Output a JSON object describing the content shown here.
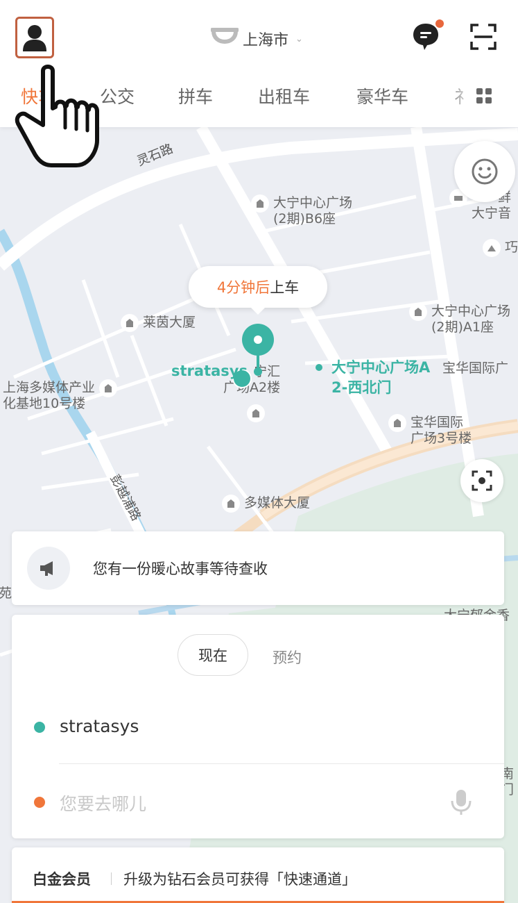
{
  "header": {
    "city": "上海市",
    "tabs": [
      {
        "label": "快车"
      },
      {
        "label": "公交"
      },
      {
        "label": "拼车"
      },
      {
        "label": "出租车"
      },
      {
        "label": "豪华车"
      },
      {
        "label": "礻"
      }
    ],
    "active_tab": "快车",
    "accent_color": "#f0763a",
    "icons": [
      "profile-icon",
      "didi-logo-icon",
      "chevron-down-icon",
      "message-icon",
      "scan-icon",
      "grid-icon"
    ]
  },
  "map": {
    "roads": [
      "灵石路",
      "彭越浦路"
    ],
    "pois": [
      {
        "name": "大宁中心广场\n(2期)B6座"
      },
      {
        "name": "莱茵大厦"
      },
      {
        "name": "大宁中心广场\n(2期)A1座"
      },
      {
        "name": "宝华国际广"
      },
      {
        "name": "上海多媒体产业\n化基地10号楼"
      },
      {
        "name": "宝华国际\n广场3号楼"
      },
      {
        "name": "多媒体大厦"
      },
      {
        "name": "宁汇\n广场A2楼"
      },
      {
        "name": "鲜\n大宁音"
      },
      {
        "name": "巧"
      },
      {
        "name": "大宁郁金香"
      },
      {
        "name": "苑"
      },
      {
        "name": "南门"
      }
    ],
    "eta_time": "4分钟后",
    "eta_rest": "上车",
    "pickup_label": "stratasys",
    "destination_label": "大宁中心广场A\n2-西北门",
    "pin_color": "#3bb4a4"
  },
  "notice": {
    "text": "您有一份暖心故事等待查收"
  },
  "booking": {
    "now_label": "现在",
    "reserve_label": "预约",
    "from_value": "stratasys",
    "to_placeholder": "您要去哪儿"
  },
  "member": {
    "title": "白金会员",
    "text": "升级为钻石会员可获得「快速通道」"
  }
}
